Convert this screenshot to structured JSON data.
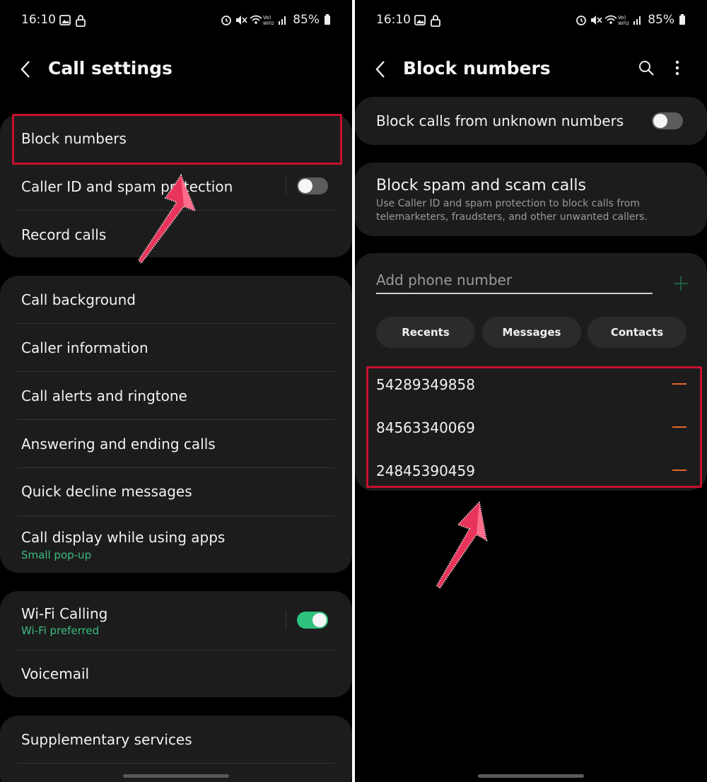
{
  "left": {
    "status": {
      "time": "16:10",
      "battery": "85%",
      "vo_label": "Vo)",
      "wifi2_label": "WiFi2"
    },
    "header": {
      "title": "Call settings"
    },
    "group1": {
      "block_numbers": "Block numbers",
      "caller_id": "Caller ID and spam protection",
      "caller_id_toggle": false,
      "record_calls": "Record calls"
    },
    "group2": {
      "call_background": "Call background",
      "caller_information": "Caller information",
      "call_alerts": "Call alerts and ringtone",
      "answering": "Answering and ending calls",
      "quick_decline": "Quick decline messages",
      "call_display": "Call display while using apps",
      "call_display_sub": "Small pop-up"
    },
    "group3": {
      "wifi_calling": "Wi-Fi Calling",
      "wifi_calling_sub": "Wi-Fi preferred",
      "wifi_calling_toggle": true,
      "voicemail": "Voicemail"
    },
    "group4": {
      "supplementary": "Supplementary services"
    }
  },
  "right": {
    "status": {
      "time": "16:10",
      "battery": "85%",
      "vo_label": "Vo)",
      "wifi2_label": "WiFi2"
    },
    "header": {
      "title": "Block numbers"
    },
    "unknown": {
      "label": "Block calls from unknown numbers",
      "toggle": false
    },
    "spam": {
      "title": "Block spam and scam calls",
      "description": "Use Caller ID and spam protection to block calls from telemarketers, fraudsters, and other unwanted callers."
    },
    "add": {
      "placeholder": "Add phone number"
    },
    "pills": {
      "recents": "Recents",
      "messages": "Messages",
      "contacts": "Contacts"
    },
    "blocked": [
      "54289349858",
      "84563340069",
      "24845390459"
    ]
  },
  "colors": {
    "accent_green": "#2ec27e",
    "highlight_red": "#c8102e",
    "minus_orange": "#e8642c",
    "arrow_pink": "#e8335a"
  },
  "icons": [
    "back-arrow-icon",
    "search-icon",
    "more-vert-icon",
    "add-icon",
    "minus-icon",
    "alarm-icon",
    "mute-icon",
    "wifi-icon",
    "signal-icon",
    "battery-icon",
    "image-icon",
    "lock-icon",
    "arrow-pointer-icon"
  ]
}
